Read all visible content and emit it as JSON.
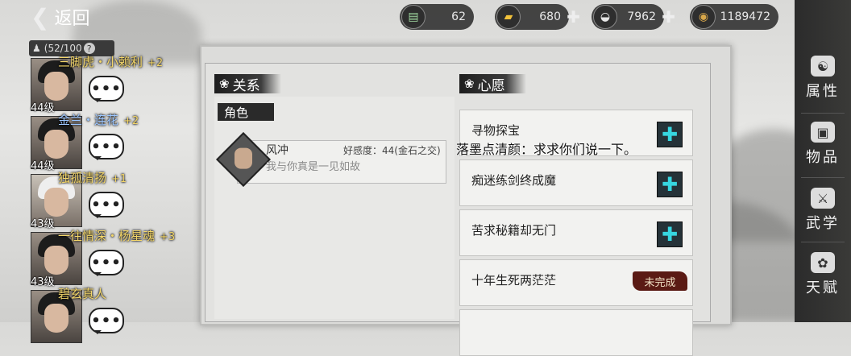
{
  "topbar": {
    "back_label": "返回",
    "resources": [
      {
        "icon": "scroll-icon",
        "value": "62",
        "has_plus": false
      },
      {
        "icon": "gold-bar-icon",
        "value": "680",
        "has_plus": true
      },
      {
        "icon": "silver-ingot-icon",
        "value": "7962",
        "has_plus": true
      },
      {
        "icon": "copper-coin-icon",
        "value": "1189472",
        "has_plus": false
      }
    ]
  },
  "party": {
    "capacity": "(52/100",
    "help": "?",
    "members": [
      {
        "name": "三脚虎・小赖利",
        "bonus": "+2",
        "level": "44级",
        "name_color": "gold"
      },
      {
        "name": "金兰・连花",
        "bonus": "+2",
        "level": "44级",
        "name_color": "blue"
      },
      {
        "name": "独孤清扬",
        "bonus": "+1",
        "level": "43级",
        "name_color": "gold"
      },
      {
        "name": "一往情深・杨星魂",
        "bonus": "+3",
        "level": "43级",
        "name_color": "gold"
      },
      {
        "name": "碧玄真人",
        "bonus": "",
        "level": "",
        "name_color": "gold"
      }
    ],
    "bubble_text": "•••"
  },
  "panel": {
    "relations_title": "关系",
    "role_tag": "角色",
    "relation": {
      "name": "风冲",
      "affection": "好感度：44(金石之交)",
      "desc": "我与你真是一见如故"
    },
    "wishes_title": "心愿",
    "wishes": [
      {
        "title": "寻物探宝",
        "action": "plus"
      },
      {
        "title": "痴迷练剑终成魔",
        "action": "plus"
      },
      {
        "title": "苦求秘籍却无门",
        "action": "plus"
      },
      {
        "title": "十年生死两茫茫",
        "action": "incomplete",
        "status": "未完成"
      },
      {
        "title": "",
        "action": "none"
      }
    ]
  },
  "chat_line": "落墨点清颜：求求你们说一下。",
  "menu": [
    {
      "label": "属性",
      "icon": "attribute-icon"
    },
    {
      "label": "物品",
      "icon": "item-icon"
    },
    {
      "label": "武学",
      "icon": "martial-arts-icon"
    },
    {
      "label": "天赋",
      "icon": "talent-icon"
    }
  ]
}
